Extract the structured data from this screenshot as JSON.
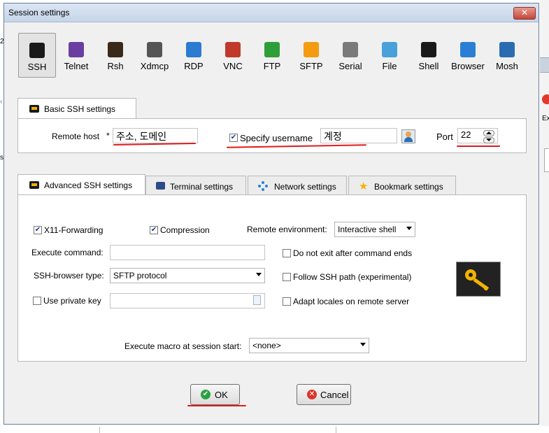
{
  "window": {
    "title": "Session settings",
    "close_glyph": "✕"
  },
  "protocols": [
    {
      "label": "SSH",
      "icon": "ssh-wrench-icon",
      "color": "#1a1a1a"
    },
    {
      "label": "Telnet",
      "icon": "telnet-icon",
      "color": "#6a3ea1"
    },
    {
      "label": "Rsh",
      "icon": "rsh-icon",
      "color": "#3b2a1a"
    },
    {
      "label": "Xdmcp",
      "icon": "xdmcp-icon",
      "color": "#555555"
    },
    {
      "label": "RDP",
      "icon": "rdp-monitor-icon",
      "color": "#2b7bd1"
    },
    {
      "label": "VNC",
      "icon": "vnc-icon",
      "color": "#c0392b"
    },
    {
      "label": "FTP",
      "icon": "ftp-globe-icon",
      "color": "#2e9e3a"
    },
    {
      "label": "SFTP",
      "icon": "sftp-globe-icon",
      "color": "#f39c12"
    },
    {
      "label": "Serial",
      "icon": "serial-plug-icon",
      "color": "#7a7a7a"
    },
    {
      "label": "File",
      "icon": "file-monitor-icon",
      "color": "#4aa0d8"
    },
    {
      "label": "Shell",
      "icon": "shell-terminal-icon",
      "color": "#1a1a1a"
    },
    {
      "label": "Browser",
      "icon": "browser-globe-icon",
      "color": "#2a7fd4"
    },
    {
      "label": "Mosh",
      "icon": "mosh-satellite-icon",
      "color": "#2b6cb0"
    }
  ],
  "basic": {
    "tab_label": "Basic SSH settings",
    "remote_host_label": "Remote host",
    "required_mark": "*",
    "remote_host_value": "주소, 도메인",
    "specify_username_label": "Specify username",
    "specify_username_checked": "✔",
    "username_value": "계정",
    "port_label": "Port",
    "port_value": "22"
  },
  "advanced_tabs": [
    {
      "label": "Advanced SSH settings",
      "icon": "wrench-icon"
    },
    {
      "label": "Terminal settings",
      "icon": "terminal-icon"
    },
    {
      "label": "Network settings",
      "icon": "network-icon"
    },
    {
      "label": "Bookmark settings",
      "icon": "star-icon"
    }
  ],
  "advanced": {
    "x11_label": "X11-Forwarding",
    "x11_check": "✔",
    "compression_label": "Compression",
    "compression_check": "✔",
    "remote_env_label": "Remote environment:",
    "remote_env_value": "Interactive shell",
    "execute_command_label": "Execute command:",
    "execute_command_value": "",
    "no_exit_label": "Do not exit after command ends",
    "ssh_browser_label": "SSH-browser type:",
    "ssh_browser_value": "SFTP protocol",
    "follow_path_label": "Follow SSH path (experimental)",
    "private_key_label": "Use private key",
    "private_key_value": "",
    "adapt_locales_label": "Adapt locales on remote server",
    "macro_label": "Execute macro at session start:",
    "macro_value": "<none>"
  },
  "buttons": {
    "ok_label": "OK",
    "cancel_label": "Cancel"
  },
  "background": {
    "fragment_e": "Ex",
    "fragment_2": "2",
    "fragment_se": "se",
    "fragment_c": "‹"
  }
}
